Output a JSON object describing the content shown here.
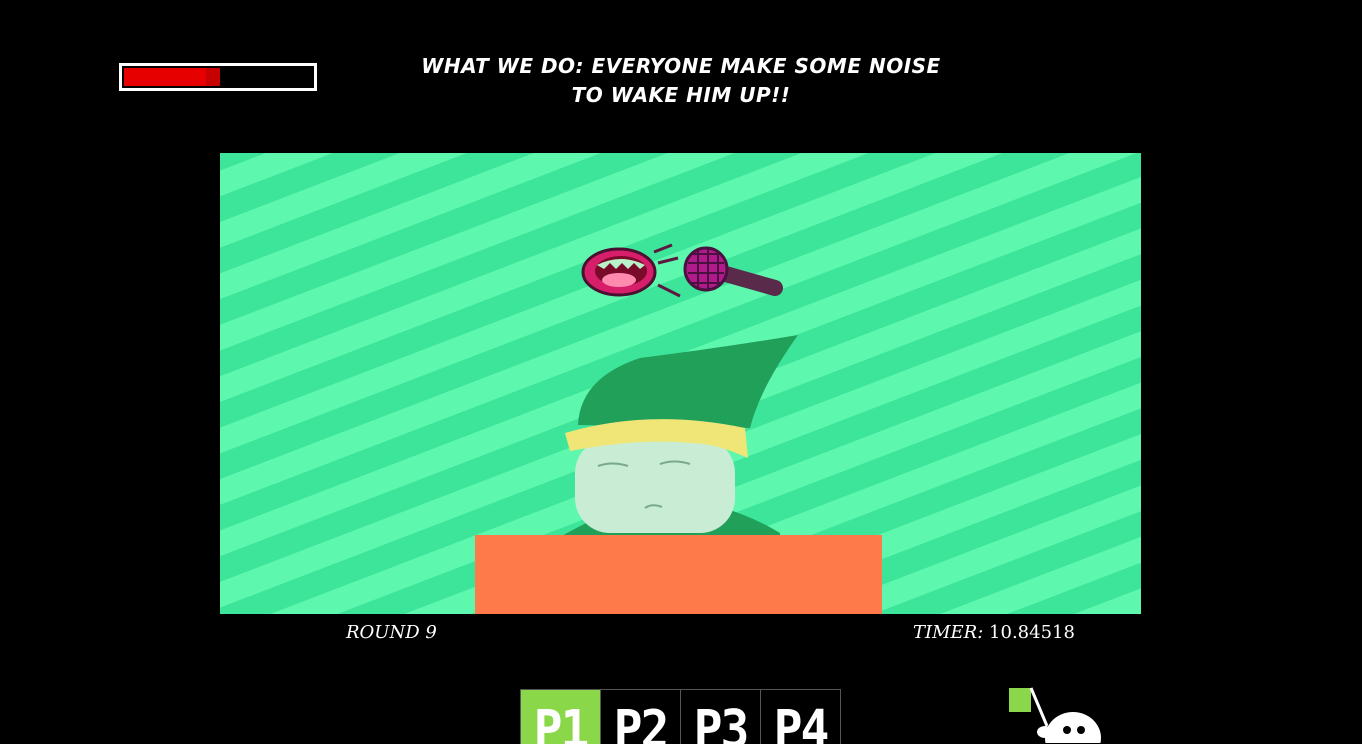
{
  "hud": {
    "health_fraction": 0.5,
    "health_color": "#e60000",
    "instruction": "WHAT WE DO: EVERYONE MAKE SOME NOISE TO WAKE HIM UP!!"
  },
  "stage": {
    "background_stripe_colors": [
      "#5ef7ae",
      "#3de59a"
    ],
    "icons": [
      "shouting-mouth-icon",
      "microphone-icon"
    ],
    "character": "sleeping-elf"
  },
  "status": {
    "round_label": "ROUND 9",
    "timer_label": "TIMER:",
    "timer_value": "10.84518"
  },
  "players": {
    "tabs": [
      "P1",
      "P2",
      "P3",
      "P4"
    ],
    "active_index": 0,
    "active_color": "#8ad84a"
  },
  "mascot": {
    "icon": "flag-ghost-icon",
    "flag_color": "#8ad84a"
  }
}
